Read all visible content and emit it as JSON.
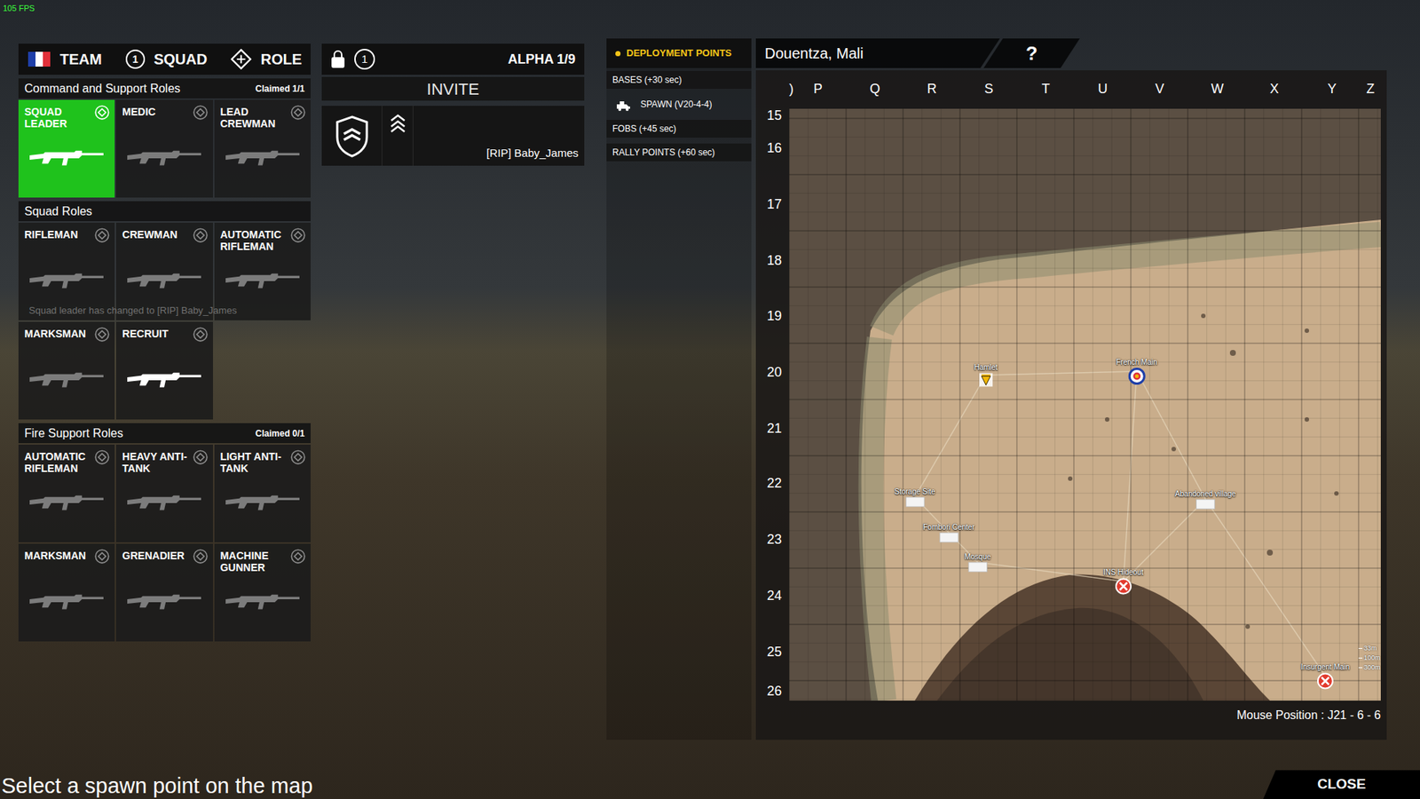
{
  "hud": {
    "fps": "105 FPS"
  },
  "header": {
    "team": "TEAM",
    "squad_number": "1",
    "squad": "SQUAD",
    "role": "ROLE"
  },
  "role_groups": [
    {
      "title": "Command and Support Roles",
      "claimed": "Claimed 1/1",
      "roles": [
        {
          "name": "SQUAD LEADER",
          "selected": true,
          "available": true
        },
        {
          "name": "MEDIC",
          "selected": false,
          "available": false
        },
        {
          "name": "LEAD CREWMAN",
          "selected": false,
          "available": false
        }
      ]
    },
    {
      "title": "Squad Roles",
      "roles": [
        {
          "name": "RIFLEMAN",
          "selected": false,
          "available": false
        },
        {
          "name": "CREWMAN",
          "selected": false,
          "available": false
        },
        {
          "name": "AUTOMATIC RIFLEMAN",
          "selected": false,
          "available": false
        },
        {
          "name": "MARKSMAN",
          "selected": false,
          "available": false
        },
        {
          "name": "RECRUIT",
          "selected": false,
          "available": true
        }
      ]
    },
    {
      "title": "Fire Support Roles",
      "claimed": "Claimed 0/1",
      "roles": [
        {
          "name": "AUTOMATIC RIFLEMAN",
          "selected": false,
          "available": false
        },
        {
          "name": "HEAVY ANTI-TANK",
          "selected": false,
          "available": false
        },
        {
          "name": "LIGHT ANTI-TANK",
          "selected": false,
          "available": false
        },
        {
          "name": "MARKSMAN",
          "selected": false,
          "available": false
        },
        {
          "name": "GRENADIER",
          "selected": false,
          "available": false
        },
        {
          "name": "MACHINE GUNNER",
          "selected": false,
          "available": false
        }
      ]
    }
  ],
  "notification": "Squad leader has changed to [RIP] Baby_James",
  "squad_panel": {
    "locked": true,
    "number": "1",
    "name": "ALPHA 1/9",
    "invite": "INVITE",
    "members": [
      {
        "name": "[RIP] Baby_James",
        "leader": true
      }
    ]
  },
  "deployment": {
    "title": "DEPLOYMENT POINTS",
    "sections": [
      {
        "label": "BASES (+30 sec)",
        "points": [
          {
            "label": "SPAWN (V20-4-4)"
          }
        ]
      },
      {
        "label": "FOBS (+45 sec)",
        "points": []
      },
      {
        "label": "RALLY POINTS (+60 sec)",
        "points": []
      }
    ]
  },
  "map": {
    "title": "Douentza, Mali",
    "help": "?",
    "columns": [
      ")",
      "P",
      "Q",
      "R",
      "S",
      "T",
      "U",
      "V",
      "W",
      "X",
      "Y",
      "Z"
    ],
    "rows": [
      "15",
      "16",
      "17",
      "18",
      "19",
      "20",
      "21",
      "22",
      "23",
      "24",
      "25",
      "26"
    ],
    "markers": [
      {
        "label": "Hamlet",
        "kind": "objective"
      },
      {
        "label": "French Main",
        "kind": "main"
      },
      {
        "label": "Storage Site",
        "kind": "point"
      },
      {
        "label": "Fombori Center",
        "kind": "point"
      },
      {
        "label": "Mosque",
        "kind": "point"
      },
      {
        "label": "Abandoned village",
        "kind": "point"
      },
      {
        "label": "INS Hideout",
        "kind": "enemy"
      },
      {
        "label": "Insurgent Main",
        "kind": "enemy"
      }
    ],
    "scale": [
      "33m",
      "100m",
      "300m"
    ],
    "mouse_position": "Mouse Position : J21 - 6 - 6"
  },
  "footer": {
    "hint": "Select a spawn point on the map",
    "close": "CLOSE"
  }
}
